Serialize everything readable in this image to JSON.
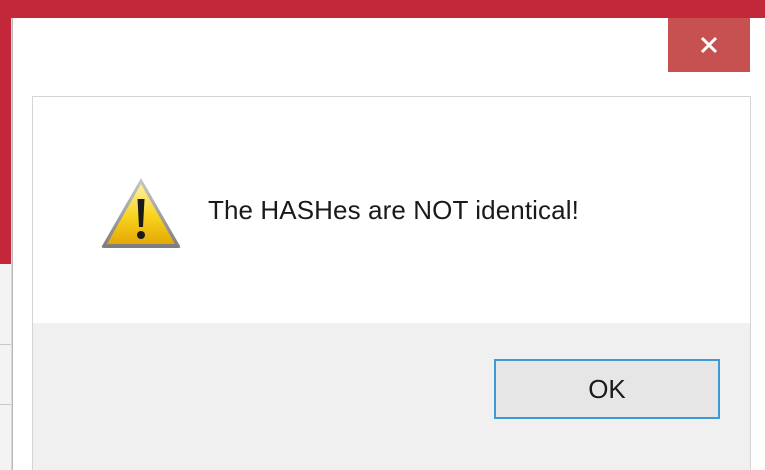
{
  "dialog": {
    "message": "The HASHes are NOT identical!",
    "ok_label": "OK",
    "icon": "warning-icon",
    "close_icon": "close-icon"
  },
  "colors": {
    "app_background": "#c2273a",
    "close_button": "#c75050",
    "button_area": "#f0f0f0",
    "ok_focus_border": "#3c9bd6"
  }
}
